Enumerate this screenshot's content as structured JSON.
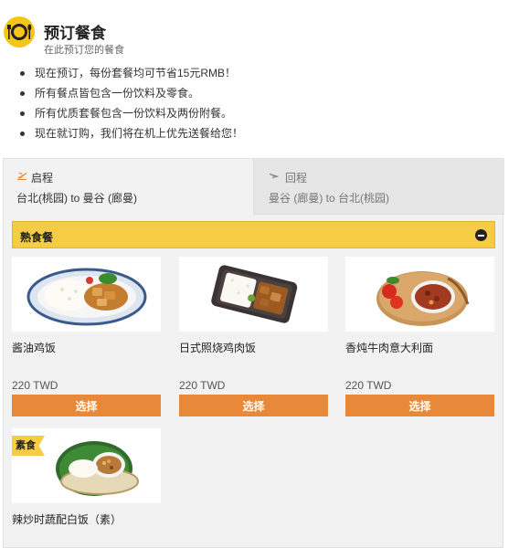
{
  "header": {
    "title": "预订餐食",
    "subtitle": "在此预订您的餐食",
    "icon": "plate-cutlery-icon",
    "accent": "#f5c518"
  },
  "bullets": [
    "现在预订，每份套餐均可节省15元RMB！",
    "所有餐点皆包含一份饮料及零食。",
    "所有优质套餐包含一份饮料及两份附餐。",
    "现在就订购，我们将在机上优先送餐给您！"
  ],
  "tabs": [
    {
      "label": "启程",
      "route": "台北(桃园) to 曼谷 (廊曼)",
      "icon": "plane-depart-icon",
      "active": true
    },
    {
      "label": "回程",
      "route": "曼谷 (廊曼) to 台北(桃园)",
      "icon": "plane-return-icon",
      "active": false
    }
  ],
  "section": {
    "label": "熟食餐",
    "collapse_icon": "minus-circle-icon",
    "color": "#f5cc44"
  },
  "meals": [
    {
      "name": "酱油鸡饭",
      "price": "220 TWD",
      "button": "选择"
    },
    {
      "name": "日式照烧鸡肉饭",
      "price": "220 TWD",
      "button": "选择"
    },
    {
      "name": "香炖牛肉意大利面",
      "price": "220 TWD",
      "button": "选择"
    },
    {
      "name": "辣炒时蔬配白饭（素）",
      "badge": "素食"
    }
  ],
  "button_color": "#e8893a"
}
